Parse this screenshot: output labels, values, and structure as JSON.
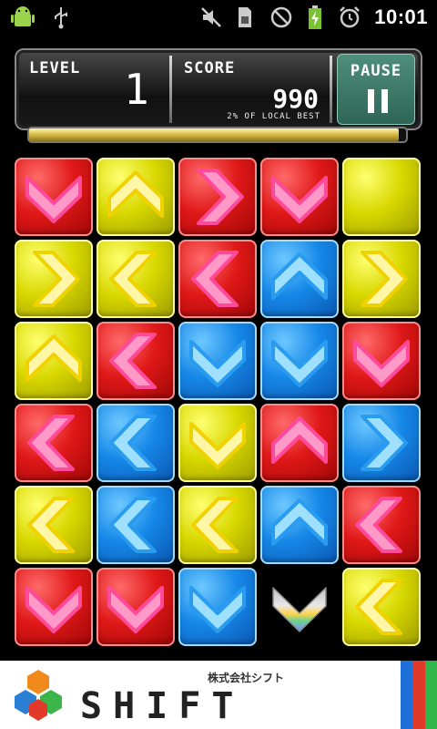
{
  "status_bar": {
    "time": "10:01",
    "icons": [
      "android-icon",
      "usb-icon",
      "mute-icon",
      "sim-icon",
      "no-signal-icon",
      "battery-charging-icon",
      "alarm-icon"
    ]
  },
  "hud": {
    "level_label": "LEVEL",
    "level_value": "1",
    "score_label": "SCORE",
    "score_value": "990",
    "best_text": "2% OF LOCAL BEST",
    "pause_label": "PAUSE",
    "progress_fraction": 0.98
  },
  "board": {
    "columns": 5,
    "rows": 6,
    "tiles": [
      [
        "red-down",
        "yellow-up",
        "red-right",
        "red-down",
        "yellow-blank"
      ],
      [
        "yellow-right",
        "yellow-left",
        "red-left",
        "blue-up",
        "yellow-right"
      ],
      [
        "yellow-up",
        "red-left",
        "blue-down",
        "blue-down",
        "red-down"
      ],
      [
        "red-left",
        "blue-left",
        "yellow-down",
        "red-up",
        "blue-right"
      ],
      [
        "yellow-left",
        "blue-left",
        "yellow-left",
        "blue-up",
        "red-left"
      ],
      [
        "red-down",
        "red-down",
        "blue-down",
        "rainbow-down",
        "yellow-left"
      ]
    ]
  },
  "footer": {
    "company_jp": "株式会社シフト",
    "brand": "SHIFT",
    "stripe_colors": [
      "#1e6fd8",
      "#e23a2a",
      "#2fb54a"
    ]
  }
}
